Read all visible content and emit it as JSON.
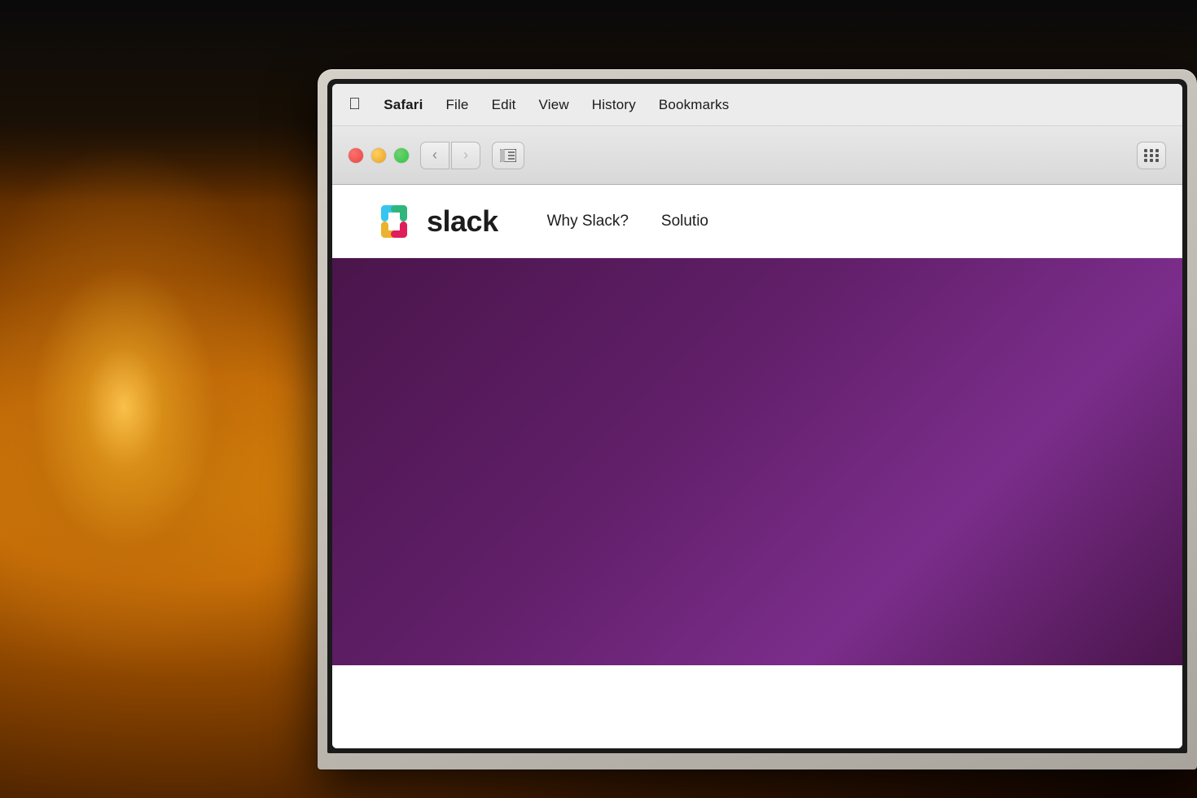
{
  "background": {
    "description": "Dark ambient background with warm lamp glow on left"
  },
  "menubar": {
    "apple_symbol": "🍎",
    "items": [
      {
        "id": "apple",
        "label": "⌘",
        "bold": false,
        "apple": true
      },
      {
        "id": "safari",
        "label": "Safari",
        "bold": true
      },
      {
        "id": "file",
        "label": "File",
        "bold": false
      },
      {
        "id": "edit",
        "label": "Edit",
        "bold": false
      },
      {
        "id": "view",
        "label": "View",
        "bold": false
      },
      {
        "id": "history",
        "label": "History",
        "bold": false
      },
      {
        "id": "bookmarks",
        "label": "Bookmarks",
        "bold": false
      }
    ]
  },
  "browser": {
    "back_button": "‹",
    "forward_button": "›",
    "sidebar_icon": "⊡",
    "grid_icon": "grid"
  },
  "webpage": {
    "slack_logo_text": "slack",
    "nav_links": [
      {
        "id": "why-slack",
        "label": "Why Slack?"
      },
      {
        "id": "solutions",
        "label": "Solutio"
      }
    ],
    "hero": {
      "background_color": "#4A154B"
    }
  },
  "colors": {
    "menu_bar_bg": "#ebebeb",
    "browser_chrome_bg": "#e0e0e0",
    "traffic_red": "#e8453c",
    "traffic_yellow": "#e8a020",
    "traffic_green": "#28c840",
    "slack_purple": "#4A154B",
    "slack_text": "#1D1C1D",
    "laptop_frame": "#c8c4bc"
  }
}
